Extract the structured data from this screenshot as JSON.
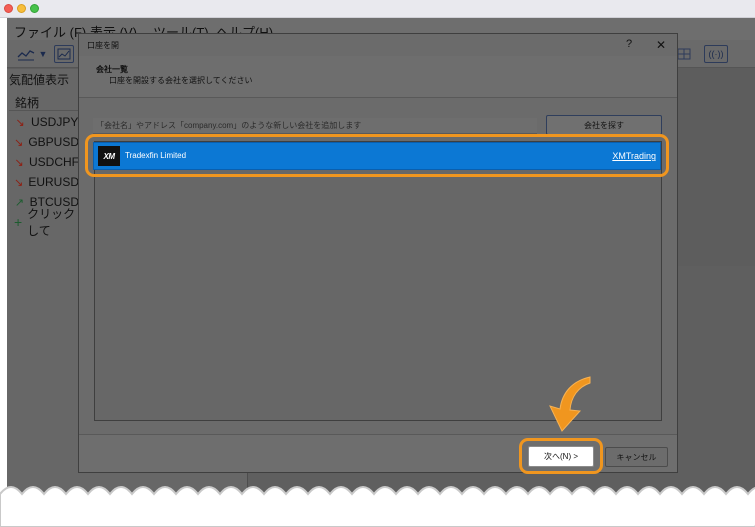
{
  "menu": {
    "file": "ファイル (F)",
    "view": "表示 (V)",
    "tools": "ツール(T)",
    "help": "ヘルプ(H)"
  },
  "market_watch": {
    "title": "気配値表示",
    "header": "銘柄",
    "symbols": [
      {
        "symbol": "USDJPY",
        "trend": "down"
      },
      {
        "symbol": "GBPUSD",
        "trend": "down"
      },
      {
        "symbol": "USDCHF",
        "trend": "down"
      },
      {
        "symbol": "EURUSD",
        "trend": "down"
      },
      {
        "symbol": "BTCUSD",
        "trend": "up"
      }
    ],
    "add_label": "クリックして"
  },
  "dialog": {
    "title": "口座を開",
    "help": "?",
    "close": "✕",
    "heading": "会社一覧",
    "subheading": "口座を開設する会社を選択してください",
    "search_placeholder": "「会社名」やアドレス「company.com」のような新しい会社を追加します",
    "find_button": "会社を探す",
    "company": {
      "logo_text": "XM",
      "name": "Tradexfin Limited",
      "server": "XMTrading"
    },
    "next_button": "次へ(N) >",
    "cancel_button": "キャンセル"
  },
  "icons": {
    "line_chart": "line-chart-icon",
    "dropdown": "chevron-down-icon",
    "chart_window": "chart-window-icon",
    "grid": "grid-layout-icon",
    "signal": "signal-icon",
    "arrow_down": "trend-down-icon",
    "arrow_up": "trend-up-icon",
    "plus": "plus-icon"
  },
  "colors": {
    "accent_highlight": "#f0961f",
    "selection_blue": "#0c78d4",
    "trend_down": "#d7341f",
    "trend_up": "#2ca24d"
  }
}
